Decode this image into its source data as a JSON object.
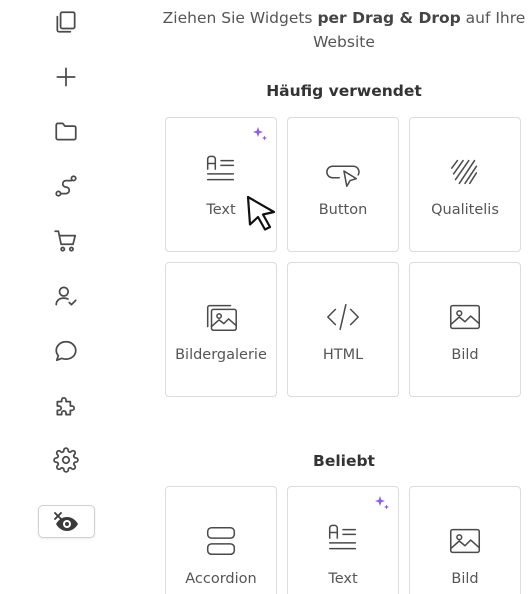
{
  "intro": {
    "part1": "Ziehen Sie Widgets ",
    "bold": "per Drag & Drop",
    "part2": " auf Ihre Website"
  },
  "sections": {
    "frequent": "Häufig verwendet",
    "popular": "Beliebt"
  },
  "widgets": {
    "text": "Text",
    "button": "Button",
    "qualitelis": "Qualitelis",
    "gallery": "Bildergalerie",
    "html": "HTML",
    "image": "Bild",
    "accordion": "Accordion",
    "text2": "Text",
    "image2": "Bild"
  },
  "colors": {
    "accent_sparkle": "#8b5cf6",
    "icon": "#4a4a4a"
  },
  "icons": {
    "sidebar": [
      "copy-icon",
      "plus-icon",
      "folder-icon",
      "route-icon",
      "cart-icon",
      "user-check-icon",
      "chat-icon",
      "puzzle-icon",
      "gear-icon"
    ],
    "preview": "eye-off-icon"
  }
}
